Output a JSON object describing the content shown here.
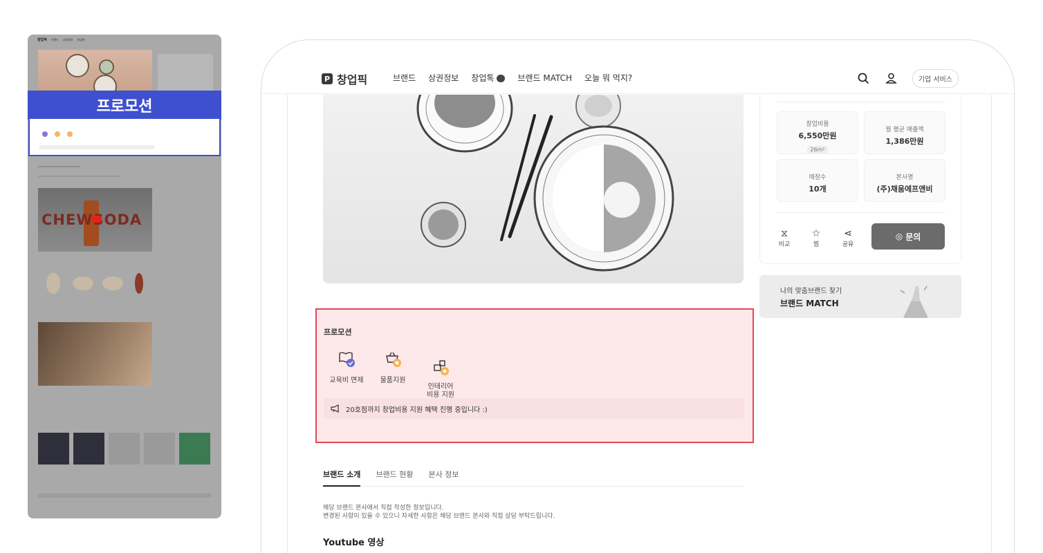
{
  "thumbnail": {
    "promo_label": "프로모션",
    "video_wordmark": "CHEWSODA"
  },
  "header": {
    "logo_text": "창업픽",
    "nav": [
      "브랜드",
      "상권정보",
      "창업톡",
      "브랜드 MATCH",
      "오늘 뭐 먹지?"
    ],
    "business_button": "기업 서비스"
  },
  "stats": [
    {
      "label": "창업비용",
      "value": "6,550만원",
      "tag": "26m²"
    },
    {
      "label": "월 평균 매출액",
      "value": "1,386만원"
    },
    {
      "label": "매장수",
      "value": "10개"
    },
    {
      "label": "본사명",
      "value": "(주)채움에프앤비"
    }
  ],
  "actions": {
    "compare": "비교",
    "save": "찜",
    "share": "공유",
    "inquire": "문의"
  },
  "match_banner": {
    "subtitle": "나의 맞춤브랜드 찾기",
    "title": "브랜드 MATCH"
  },
  "promotion": {
    "title": "프로모션",
    "benefits": [
      {
        "label": "교육비 면제",
        "icon": "book-check-icon"
      },
      {
        "label": "물품지원",
        "icon": "basket-icon"
      },
      {
        "label": "인테리어\n비용 지원",
        "icon": "interior-icon"
      }
    ],
    "notice": "20호점까지 창업비용 지원 혜택 진행 중입니다 :)"
  },
  "tabs": [
    "브랜드 소개",
    "브랜드 현황",
    "본사 정보"
  ],
  "description": [
    "해당 브랜드 본사에서 직접 작성한 정보입니다.",
    "변경된 사항이 있을 수 있으니 자세한 사항은 해당 브랜드 본사와 직접 상담 부탁드립니다."
  ],
  "youtube_heading": "Youtube 영상",
  "colors": {
    "promo_highlight": "#e64657",
    "promo_bg": "#fde8ea",
    "thumb_accent": "#3e4fcf",
    "benefit_purple": "#6a6ad0",
    "benefit_orange": "#f2b552"
  }
}
